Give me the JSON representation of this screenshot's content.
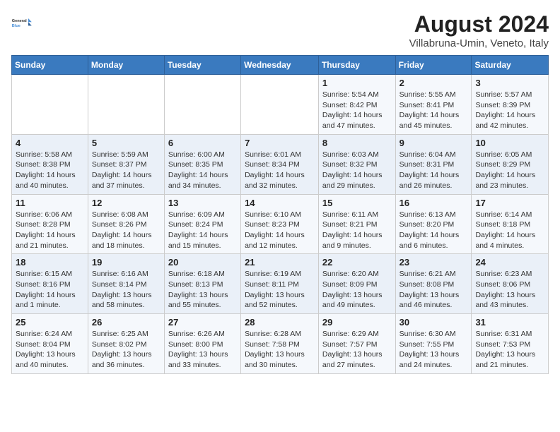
{
  "logo": {
    "line1": "General",
    "line2": "Blue"
  },
  "title": "August 2024",
  "subtitle": "Villabruna-Umin, Veneto, Italy",
  "days_of_week": [
    "Sunday",
    "Monday",
    "Tuesday",
    "Wednesday",
    "Thursday",
    "Friday",
    "Saturday"
  ],
  "weeks": [
    [
      {
        "day": "",
        "info": ""
      },
      {
        "day": "",
        "info": ""
      },
      {
        "day": "",
        "info": ""
      },
      {
        "day": "",
        "info": ""
      },
      {
        "day": "1",
        "info": "Sunrise: 5:54 AM\nSunset: 8:42 PM\nDaylight: 14 hours and 47 minutes."
      },
      {
        "day": "2",
        "info": "Sunrise: 5:55 AM\nSunset: 8:41 PM\nDaylight: 14 hours and 45 minutes."
      },
      {
        "day": "3",
        "info": "Sunrise: 5:57 AM\nSunset: 8:39 PM\nDaylight: 14 hours and 42 minutes."
      }
    ],
    [
      {
        "day": "4",
        "info": "Sunrise: 5:58 AM\nSunset: 8:38 PM\nDaylight: 14 hours and 40 minutes."
      },
      {
        "day": "5",
        "info": "Sunrise: 5:59 AM\nSunset: 8:37 PM\nDaylight: 14 hours and 37 minutes."
      },
      {
        "day": "6",
        "info": "Sunrise: 6:00 AM\nSunset: 8:35 PM\nDaylight: 14 hours and 34 minutes."
      },
      {
        "day": "7",
        "info": "Sunrise: 6:01 AM\nSunset: 8:34 PM\nDaylight: 14 hours and 32 minutes."
      },
      {
        "day": "8",
        "info": "Sunrise: 6:03 AM\nSunset: 8:32 PM\nDaylight: 14 hours and 29 minutes."
      },
      {
        "day": "9",
        "info": "Sunrise: 6:04 AM\nSunset: 8:31 PM\nDaylight: 14 hours and 26 minutes."
      },
      {
        "day": "10",
        "info": "Sunrise: 6:05 AM\nSunset: 8:29 PM\nDaylight: 14 hours and 23 minutes."
      }
    ],
    [
      {
        "day": "11",
        "info": "Sunrise: 6:06 AM\nSunset: 8:28 PM\nDaylight: 14 hours and 21 minutes."
      },
      {
        "day": "12",
        "info": "Sunrise: 6:08 AM\nSunset: 8:26 PM\nDaylight: 14 hours and 18 minutes."
      },
      {
        "day": "13",
        "info": "Sunrise: 6:09 AM\nSunset: 8:24 PM\nDaylight: 14 hours and 15 minutes."
      },
      {
        "day": "14",
        "info": "Sunrise: 6:10 AM\nSunset: 8:23 PM\nDaylight: 14 hours and 12 minutes."
      },
      {
        "day": "15",
        "info": "Sunrise: 6:11 AM\nSunset: 8:21 PM\nDaylight: 14 hours and 9 minutes."
      },
      {
        "day": "16",
        "info": "Sunrise: 6:13 AM\nSunset: 8:20 PM\nDaylight: 14 hours and 6 minutes."
      },
      {
        "day": "17",
        "info": "Sunrise: 6:14 AM\nSunset: 8:18 PM\nDaylight: 14 hours and 4 minutes."
      }
    ],
    [
      {
        "day": "18",
        "info": "Sunrise: 6:15 AM\nSunset: 8:16 PM\nDaylight: 14 hours and 1 minute."
      },
      {
        "day": "19",
        "info": "Sunrise: 6:16 AM\nSunset: 8:14 PM\nDaylight: 13 hours and 58 minutes."
      },
      {
        "day": "20",
        "info": "Sunrise: 6:18 AM\nSunset: 8:13 PM\nDaylight: 13 hours and 55 minutes."
      },
      {
        "day": "21",
        "info": "Sunrise: 6:19 AM\nSunset: 8:11 PM\nDaylight: 13 hours and 52 minutes."
      },
      {
        "day": "22",
        "info": "Sunrise: 6:20 AM\nSunset: 8:09 PM\nDaylight: 13 hours and 49 minutes."
      },
      {
        "day": "23",
        "info": "Sunrise: 6:21 AM\nSunset: 8:08 PM\nDaylight: 13 hours and 46 minutes."
      },
      {
        "day": "24",
        "info": "Sunrise: 6:23 AM\nSunset: 8:06 PM\nDaylight: 13 hours and 43 minutes."
      }
    ],
    [
      {
        "day": "25",
        "info": "Sunrise: 6:24 AM\nSunset: 8:04 PM\nDaylight: 13 hours and 40 minutes."
      },
      {
        "day": "26",
        "info": "Sunrise: 6:25 AM\nSunset: 8:02 PM\nDaylight: 13 hours and 36 minutes."
      },
      {
        "day": "27",
        "info": "Sunrise: 6:26 AM\nSunset: 8:00 PM\nDaylight: 13 hours and 33 minutes."
      },
      {
        "day": "28",
        "info": "Sunrise: 6:28 AM\nSunset: 7:58 PM\nDaylight: 13 hours and 30 minutes."
      },
      {
        "day": "29",
        "info": "Sunrise: 6:29 AM\nSunset: 7:57 PM\nDaylight: 13 hours and 27 minutes."
      },
      {
        "day": "30",
        "info": "Sunrise: 6:30 AM\nSunset: 7:55 PM\nDaylight: 13 hours and 24 minutes."
      },
      {
        "day": "31",
        "info": "Sunrise: 6:31 AM\nSunset: 7:53 PM\nDaylight: 13 hours and 21 minutes."
      }
    ]
  ]
}
